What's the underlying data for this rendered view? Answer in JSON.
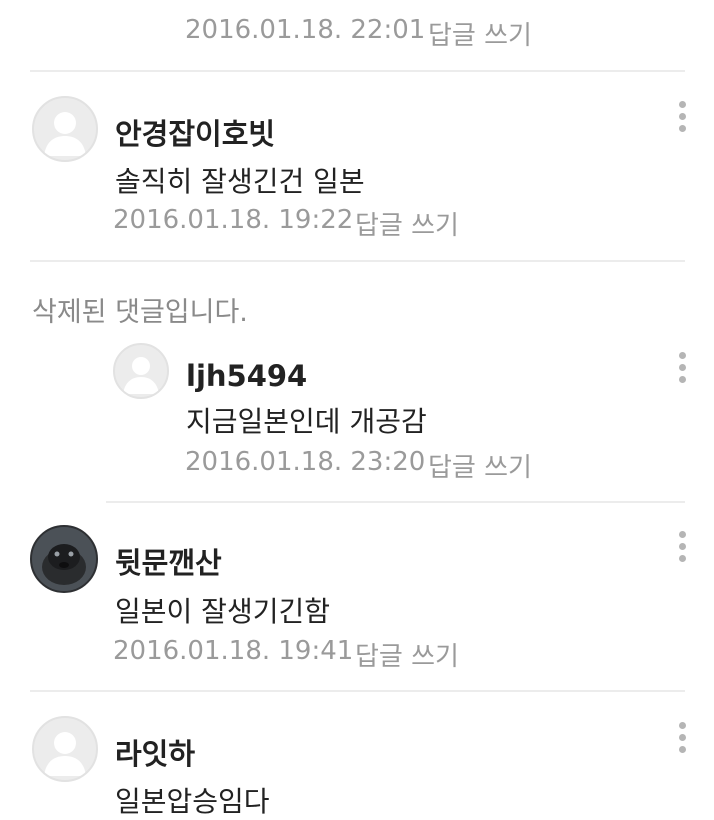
{
  "top_meta": {
    "timestamp": "2016.01.18. 22:01",
    "reply_label": "답글 쓰기"
  },
  "comments": [
    {
      "author": "안경잡이호빗",
      "text": "솔직히 잘생긴건 일본",
      "timestamp": "2016.01.18. 19:22",
      "reply_label": "답글 쓰기",
      "avatar": "default-avatar"
    },
    {
      "deleted_text": "삭제된 댓글입니다."
    },
    {
      "author": "ljh5494",
      "text": "지금일본인데 개공감",
      "timestamp": "2016.01.18. 23:20",
      "reply_label": "답글 쓰기",
      "avatar": "default-avatar"
    },
    {
      "author": "뒷문깬산",
      "text": "일본이 잘생기긴함",
      "timestamp": "2016.01.18. 19:41",
      "reply_label": "답글 쓰기",
      "avatar": "animal-photo-avatar"
    },
    {
      "author": "라잇하",
      "text": "일본압승임다",
      "avatar": "default-avatar"
    }
  ],
  "icons": {
    "more": "more-vertical-icon"
  },
  "colors": {
    "meta": "#9a9a9a",
    "divider": "#ececec",
    "text": "#222222"
  }
}
